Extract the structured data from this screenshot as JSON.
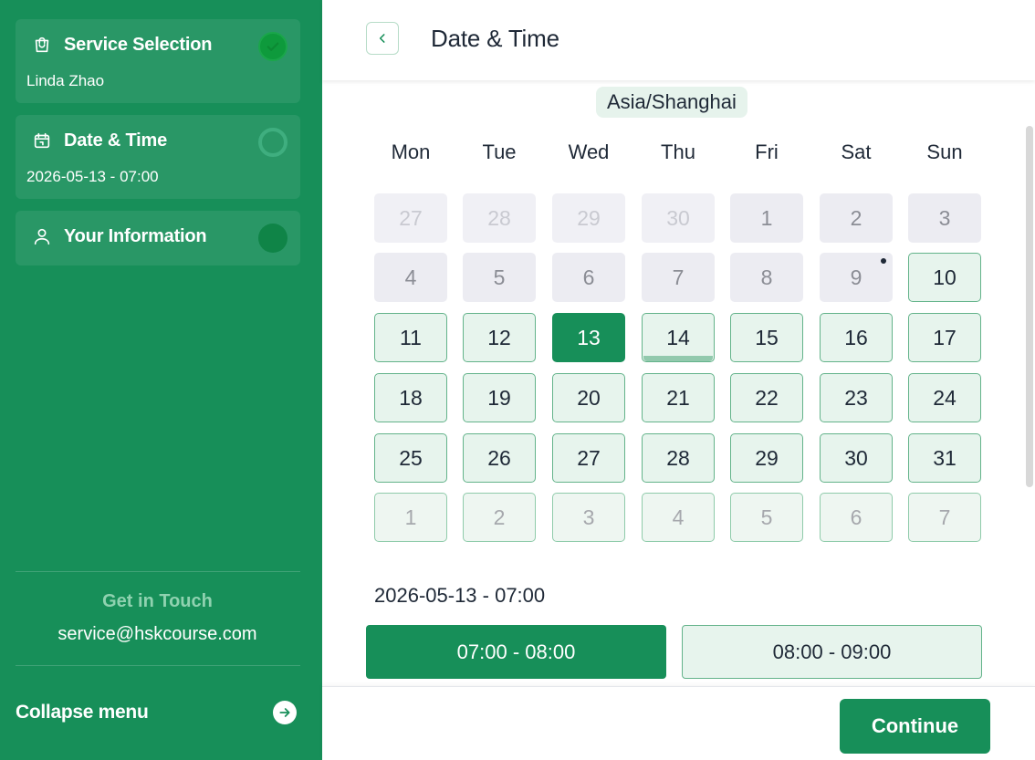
{
  "colors": {
    "brand": "#178f59",
    "available_bg": "#e7f4ed",
    "available_border": "#63b38a",
    "past_bg": "#ececf2"
  },
  "sidebar": {
    "steps": [
      {
        "title": "Service Selection",
        "subtitle": "Linda Zhao",
        "icon": "shopping-bag-icon",
        "status": "completed"
      },
      {
        "title": "Date & Time",
        "subtitle": "2026-05-13 - 07:00",
        "icon": "calendar-icon",
        "status": "current"
      },
      {
        "title": "Your Information",
        "subtitle": "",
        "icon": "user-icon",
        "status": "pending"
      }
    ],
    "contact": {
      "title": "Get in Touch",
      "email": "service@hskcourse.com"
    },
    "collapse_label": "Collapse menu",
    "collapse_icon": "arrow-right-circle-icon"
  },
  "header": {
    "title": "Date & Time",
    "back_icon": "chevron-left-icon"
  },
  "calendar": {
    "timezone": "Asia/Shanghai",
    "weekdays": [
      "Mon",
      "Tue",
      "Wed",
      "Thu",
      "Fri",
      "Sat",
      "Sun"
    ],
    "weeks": [
      [
        "27",
        "28",
        "29",
        "30",
        "1",
        "2",
        "3"
      ],
      [
        "4",
        "5",
        "6",
        "7",
        "8",
        "9",
        "10"
      ],
      [
        "11",
        "12",
        "13",
        "14",
        "15",
        "16",
        "17"
      ],
      [
        "18",
        "19",
        "20",
        "21",
        "22",
        "23",
        "24"
      ],
      [
        "25",
        "26",
        "27",
        "28",
        "29",
        "30",
        "31"
      ],
      [
        "1",
        "2",
        "3",
        "4",
        "5",
        "6",
        "7"
      ]
    ],
    "selected_day": "13",
    "today_day": "9"
  },
  "selection": {
    "label": "2026-05-13 - 07:00",
    "slots": [
      {
        "label": "07:00 - 08:00",
        "selected": true
      },
      {
        "label": "08:00 - 09:00",
        "selected": false
      }
    ]
  },
  "footer": {
    "continue_label": "Continue"
  }
}
